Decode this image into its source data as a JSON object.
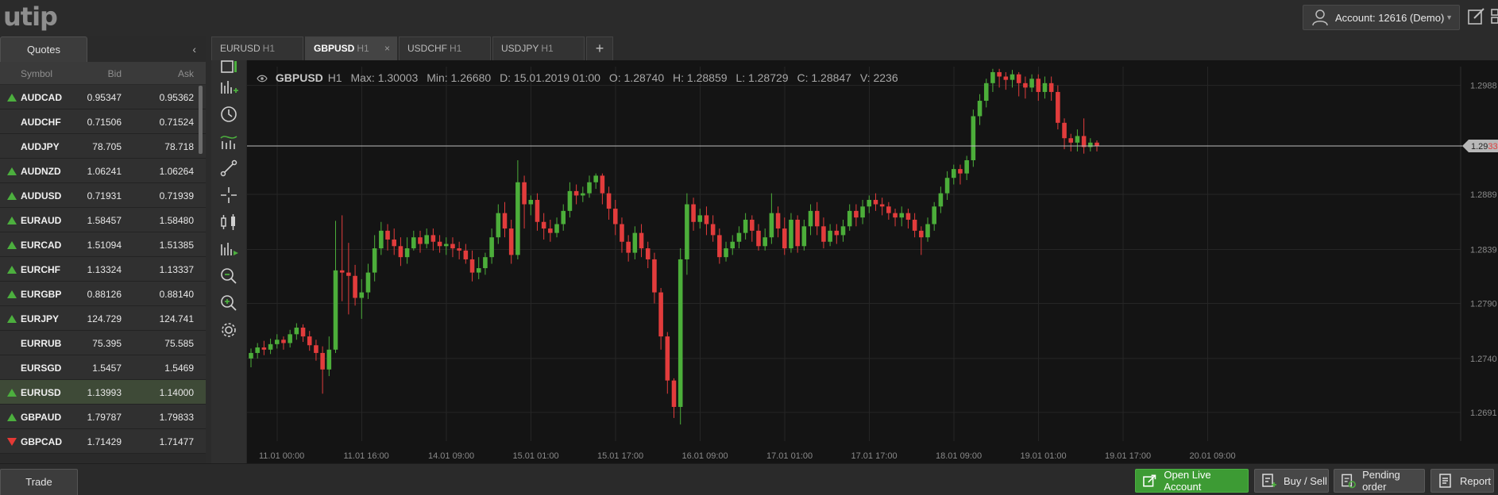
{
  "header": {
    "logo": "utip",
    "account_label": "Account: 12616 (Demo)"
  },
  "quotes": {
    "tab_label": "Quotes",
    "columns": {
      "symbol": "Symbol",
      "bid": "Bid",
      "ask": "Ask"
    },
    "rows": [
      {
        "symbol": "AUDCAD",
        "bid": "0.95347",
        "ask": "0.95362",
        "dir": "up"
      },
      {
        "symbol": "AUDCHF",
        "bid": "0.71506",
        "ask": "0.71524",
        "dir": ""
      },
      {
        "symbol": "AUDJPY",
        "bid": "78.705",
        "ask": "78.718",
        "dir": ""
      },
      {
        "symbol": "AUDNZD",
        "bid": "1.06241",
        "ask": "1.06264",
        "dir": "up"
      },
      {
        "symbol": "AUDUSD",
        "bid": "0.71931",
        "ask": "0.71939",
        "dir": "up"
      },
      {
        "symbol": "EURAUD",
        "bid": "1.58457",
        "ask": "1.58480",
        "dir": "up"
      },
      {
        "symbol": "EURCAD",
        "bid": "1.51094",
        "ask": "1.51385",
        "dir": "up"
      },
      {
        "symbol": "EURCHF",
        "bid": "1.13324",
        "ask": "1.13337",
        "dir": "up"
      },
      {
        "symbol": "EURGBP",
        "bid": "0.88126",
        "ask": "0.88140",
        "dir": "up"
      },
      {
        "symbol": "EURJPY",
        "bid": "124.729",
        "ask": "124.741",
        "dir": "up"
      },
      {
        "symbol": "EURRUB",
        "bid": "75.395",
        "ask": "75.585",
        "dir": ""
      },
      {
        "symbol": "EURSGD",
        "bid": "1.5457",
        "ask": "1.5469",
        "dir": ""
      },
      {
        "symbol": "EURUSD",
        "bid": "1.13993",
        "ask": "1.14000",
        "dir": "up",
        "selected": true
      },
      {
        "symbol": "GBPAUD",
        "bid": "1.79787",
        "ask": "1.79833",
        "dir": "up"
      },
      {
        "symbol": "GBPCAD",
        "bid": "1.71429",
        "ask": "1.71477",
        "dir": "down"
      }
    ]
  },
  "chart_tabs": [
    {
      "symbol": "EURUSD",
      "tf": "H1",
      "active": false
    },
    {
      "symbol": "GBPUSD",
      "tf": "H1",
      "active": true,
      "close": "×"
    },
    {
      "symbol": "USDCHF",
      "tf": "H1",
      "active": false
    },
    {
      "symbol": "USDJPY",
      "tf": "H1",
      "active": false
    }
  ],
  "chart_tab_add": "+",
  "chart_info": {
    "symbol": "GBPUSD",
    "timeframe": "H1",
    "max": "Max: 1.30003",
    "min": "Min: 1.26680",
    "date": "D: 15.01.2019 01:00",
    "open": "O: 1.28740",
    "high": "H: 1.28859",
    "low": "L: 1.28729",
    "close": "C: 1.28847",
    "volume": "V: 2236"
  },
  "chart_data": {
    "type": "candlestick",
    "x_ticks": [
      "11.01 00:00",
      "11.01 16:00",
      "14.01 09:00",
      "15.01 01:00",
      "15.01 17:00",
      "16.01 09:00",
      "17.01 01:00",
      "17.01 17:00",
      "18.01 09:00",
      "19.01 01:00",
      "19.01 17:00",
      "20.01 09:00"
    ],
    "y_ticks": [
      "1.2988",
      "1.2889",
      "1.2839",
      "1.2790",
      "1.2740",
      "1.2691"
    ],
    "ylim": [
      1.2665,
      1.3005
    ],
    "current_price_label": "1.2933",
    "current_price_label_prefix": "1.29",
    "current_price_label_suffix": "33",
    "current_price": 1.2933,
    "colors": {
      "up": "#4cae3a",
      "down": "#e23c3c",
      "grid": "#262626",
      "axis_text": "#8a8a8a"
    },
    "candles": [
      [
        1.274,
        1.2745,
        1.2732,
        1.2749
      ],
      [
        1.2745,
        1.275,
        1.274,
        1.2754
      ],
      [
        1.275,
        1.2748,
        1.2743,
        1.2756
      ],
      [
        1.2748,
        1.2753,
        1.2744,
        1.2758
      ],
      [
        1.2753,
        1.2757,
        1.2749,
        1.2762
      ],
      [
        1.2757,
        1.2754,
        1.2748,
        1.276
      ],
      [
        1.2754,
        1.2762,
        1.275,
        1.2766
      ],
      [
        1.2762,
        1.2768,
        1.2757,
        1.2772
      ],
      [
        1.2768,
        1.276,
        1.2755,
        1.2771
      ],
      [
        1.276,
        1.2752,
        1.2747,
        1.2765
      ],
      [
        1.2752,
        1.2745,
        1.2738,
        1.2757
      ],
      [
        1.2745,
        1.273,
        1.2708,
        1.2751
      ],
      [
        1.273,
        1.2748,
        1.2724,
        1.276
      ],
      [
        1.2748,
        1.282,
        1.2745,
        1.2865
      ],
      [
        1.282,
        1.2818,
        1.2792,
        1.287
      ],
      [
        1.2818,
        1.2815,
        1.278,
        1.2845
      ],
      [
        1.2815,
        1.2795,
        1.2788,
        1.2825
      ],
      [
        1.2795,
        1.28,
        1.2776,
        1.2812
      ],
      [
        1.28,
        1.2818,
        1.2794,
        1.2826
      ],
      [
        1.2818,
        1.284,
        1.281,
        1.2852
      ],
      [
        1.284,
        1.2856,
        1.2834,
        1.2864
      ],
      [
        1.2856,
        1.2848,
        1.2838,
        1.2862
      ],
      [
        1.2848,
        1.2842,
        1.2834,
        1.2858
      ],
      [
        1.2842,
        1.2832,
        1.2824,
        1.285
      ],
      [
        1.2832,
        1.284,
        1.2826,
        1.285
      ],
      [
        1.284,
        1.285,
        1.2838,
        1.2856
      ],
      [
        1.285,
        1.2844,
        1.2836,
        1.2856
      ],
      [
        1.2844,
        1.2852,
        1.284,
        1.2858
      ],
      [
        1.2852,
        1.2846,
        1.2838,
        1.2858
      ],
      [
        1.2846,
        1.2842,
        1.2836,
        1.2852
      ],
      [
        1.2842,
        1.2844,
        1.2834,
        1.285
      ],
      [
        1.2844,
        1.284,
        1.2832,
        1.285
      ],
      [
        1.284,
        1.2838,
        1.283,
        1.2846
      ],
      [
        1.2838,
        1.283,
        1.2826,
        1.2844
      ],
      [
        1.283,
        1.2818,
        1.281,
        1.2838
      ],
      [
        1.2818,
        1.2822,
        1.2812,
        1.2832
      ],
      [
        1.2822,
        1.2832,
        1.2816,
        1.2836
      ],
      [
        1.2832,
        1.285,
        1.2826,
        1.2858
      ],
      [
        1.285,
        1.2872,
        1.2844,
        1.288
      ],
      [
        1.2872,
        1.2858,
        1.285,
        1.2882
      ],
      [
        1.2858,
        1.2834,
        1.2826,
        1.2866
      ],
      [
        1.2834,
        1.29,
        1.283,
        1.292
      ],
      [
        1.29,
        1.288,
        1.2858,
        1.2906
      ],
      [
        1.288,
        1.2884,
        1.287,
        1.2888
      ],
      [
        1.2884,
        1.2864,
        1.2856,
        1.289
      ],
      [
        1.2864,
        1.2858,
        1.2848,
        1.2872
      ],
      [
        1.2858,
        1.2854,
        1.2846,
        1.2866
      ],
      [
        1.2854,
        1.2862,
        1.285,
        1.2868
      ],
      [
        1.2862,
        1.2874,
        1.2856,
        1.288
      ],
      [
        1.2874,
        1.2892,
        1.2868,
        1.29
      ],
      [
        1.2892,
        1.2888,
        1.288,
        1.2898
      ],
      [
        1.2888,
        1.289,
        1.2882,
        1.2896
      ],
      [
        1.289,
        1.29,
        1.2886,
        1.2906
      ],
      [
        1.29,
        1.2906,
        1.2894,
        1.2908
      ],
      [
        1.2906,
        1.289,
        1.288,
        1.2908
      ],
      [
        1.289,
        1.2876,
        1.2866,
        1.2896
      ],
      [
        1.2876,
        1.2862,
        1.2852,
        1.2884
      ],
      [
        1.2862,
        1.2846,
        1.2836,
        1.2868
      ],
      [
        1.2846,
        1.2836,
        1.2828,
        1.2852
      ],
      [
        1.2836,
        1.2854,
        1.283,
        1.286
      ],
      [
        1.2854,
        1.284,
        1.2832,
        1.2862
      ],
      [
        1.284,
        1.283,
        1.2822,
        1.2846
      ],
      [
        1.283,
        1.28,
        1.279,
        1.2836
      ],
      [
        1.28,
        1.276,
        1.2748,
        1.2804
      ],
      [
        1.276,
        1.272,
        1.2708,
        1.2764
      ],
      [
        1.272,
        1.2696,
        1.2686,
        1.2722
      ],
      [
        1.2696,
        1.283,
        1.268,
        1.284
      ],
      [
        1.283,
        1.288,
        1.2816,
        1.289
      ],
      [
        1.288,
        1.2864,
        1.2856,
        1.2886
      ],
      [
        1.2864,
        1.287,
        1.2858,
        1.2876
      ],
      [
        1.287,
        1.2862,
        1.2852,
        1.2878
      ],
      [
        1.2862,
        1.2852,
        1.2846,
        1.287
      ],
      [
        1.2852,
        1.2832,
        1.2826,
        1.2858
      ],
      [
        1.2832,
        1.284,
        1.2828,
        1.2846
      ],
      [
        1.284,
        1.2846,
        1.2834,
        1.2852
      ],
      [
        1.2846,
        1.2854,
        1.284,
        1.286
      ],
      [
        1.2854,
        1.2866,
        1.2848,
        1.2872
      ],
      [
        1.2866,
        1.2856,
        1.2846,
        1.287
      ],
      [
        1.2856,
        1.2842,
        1.2838,
        1.2862
      ],
      [
        1.2842,
        1.285,
        1.2838,
        1.2858
      ],
      [
        1.285,
        1.2872,
        1.2844,
        1.289
      ],
      [
        1.2872,
        1.2858,
        1.285,
        1.2878
      ],
      [
        1.2858,
        1.284,
        1.2834,
        1.2868
      ],
      [
        1.284,
        1.2866,
        1.2836,
        1.2872
      ],
      [
        1.2866,
        1.2842,
        1.2836,
        1.287
      ],
      [
        1.2842,
        1.286,
        1.2838,
        1.2866
      ],
      [
        1.286,
        1.2874,
        1.2852,
        1.288
      ],
      [
        1.2874,
        1.286,
        1.2852,
        1.2882
      ],
      [
        1.286,
        1.2846,
        1.284,
        1.2868
      ],
      [
        1.2846,
        1.2856,
        1.2842,
        1.2862
      ],
      [
        1.2856,
        1.2852,
        1.2844,
        1.2862
      ],
      [
        1.2852,
        1.286,
        1.2846,
        1.2866
      ],
      [
        1.286,
        1.2874,
        1.2856,
        1.288
      ],
      [
        1.2874,
        1.2868,
        1.286,
        1.288
      ],
      [
        1.2868,
        1.2878,
        1.2862,
        1.2884
      ],
      [
        1.2878,
        1.2884,
        1.2872,
        1.2888
      ],
      [
        1.2884,
        1.288,
        1.2874,
        1.289
      ],
      [
        1.288,
        1.2878,
        1.287,
        1.2886
      ],
      [
        1.2878,
        1.2872,
        1.2866,
        1.2882
      ],
      [
        1.2872,
        1.2868,
        1.286,
        1.2876
      ],
      [
        1.2868,
        1.2872,
        1.286,
        1.2878
      ],
      [
        1.2872,
        1.2866,
        1.2858,
        1.2876
      ],
      [
        1.2866,
        1.2856,
        1.285,
        1.2872
      ],
      [
        1.2856,
        1.285,
        1.2834,
        1.286
      ],
      [
        1.285,
        1.2862,
        1.2846,
        1.2868
      ],
      [
        1.2862,
        1.2878,
        1.2856,
        1.2882
      ],
      [
        1.2878,
        1.289,
        1.2872,
        1.2896
      ],
      [
        1.289,
        1.2904,
        1.2884,
        1.291
      ],
      [
        1.2904,
        1.2912,
        1.2898,
        1.2916
      ],
      [
        1.2912,
        1.2908,
        1.2898,
        1.2916
      ],
      [
        1.2908,
        1.292,
        1.2902,
        1.2924
      ],
      [
        1.292,
        1.296,
        1.2914,
        1.2966
      ],
      [
        1.296,
        1.2974,
        1.2952,
        1.298
      ],
      [
        1.2974,
        1.299,
        1.2968,
        1.2994
      ],
      [
        1.299,
        1.3,
        1.2982,
        1.3003
      ],
      [
        1.3,
        1.2996,
        1.2986,
        1.3003
      ],
      [
        1.2996,
        1.2993,
        1.2984,
        1.3
      ],
      [
        1.2993,
        1.2998,
        1.2986,
        1.3002
      ],
      [
        1.2998,
        1.299,
        1.2978,
        1.3
      ],
      [
        1.299,
        1.2986,
        1.2976,
        1.2996
      ],
      [
        1.2986,
        1.2994,
        1.2982,
        1.2998
      ],
      [
        1.2994,
        1.2982,
        1.2974,
        1.2998
      ],
      [
        1.2982,
        1.299,
        1.2976,
        1.2996
      ],
      [
        1.299,
        1.2982,
        1.2974,
        1.2996
      ],
      [
        1.2982,
        1.2954,
        1.2948,
        1.2988
      ],
      [
        1.2954,
        1.294,
        1.293,
        1.2958
      ],
      [
        1.294,
        1.2936,
        1.2928,
        1.2944
      ],
      [
        1.2936,
        1.2942,
        1.2928,
        1.2948
      ],
      [
        1.2942,
        1.2932,
        1.2926,
        1.2958
      ],
      [
        1.2932,
        1.2936,
        1.2928,
        1.294
      ],
      [
        1.2936,
        1.2933,
        1.2928,
        1.2938
      ]
    ]
  },
  "bottom": {
    "trade_tab": "Trade",
    "open_live_account": "Open Live Account",
    "buy_sell": "Buy / Sell",
    "pending_order": "Pending order",
    "report": "Report"
  }
}
